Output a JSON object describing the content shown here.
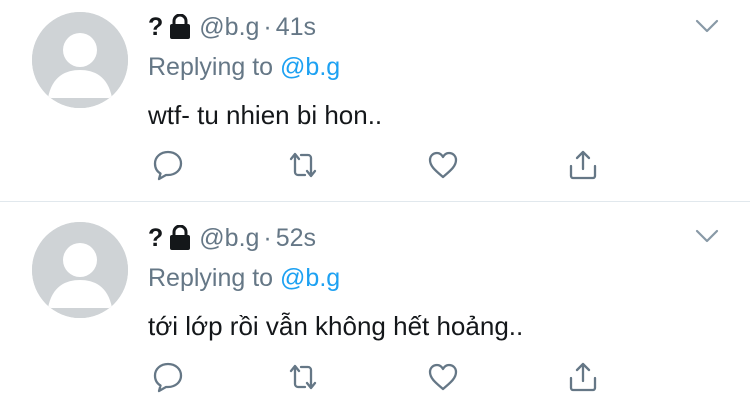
{
  "colors": {
    "text_primary": "#14171a",
    "text_secondary": "#657786",
    "link": "#1da1f2",
    "divider": "#e1e8ed",
    "avatar_bg": "#cfd3d6"
  },
  "icons": {
    "lock": "lock-icon",
    "chevron": "chevron-down-icon",
    "reply": "reply-icon",
    "retweet": "retweet-icon",
    "like": "like-icon",
    "share": "share-icon"
  },
  "tweets": [
    {
      "name": "?",
      "handle": "@b.g",
      "separator": "·",
      "time": "41s",
      "replying_prefix": "Replying to",
      "replying_to": "@b.g",
      "text": "wtf- tu nhien bi hon.."
    },
    {
      "name": "?",
      "handle": "@b.g",
      "separator": "·",
      "time": "52s",
      "replying_prefix": "Replying to",
      "replying_to": "@b.g",
      "text": "tới lớp rồi vẫn không hết hoảng.."
    }
  ]
}
